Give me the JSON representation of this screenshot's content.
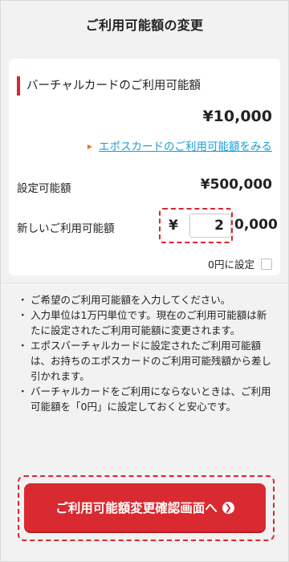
{
  "header": {
    "title": "ご利用可能額の変更"
  },
  "virtual_card": {
    "section_title": "バーチャルカードのご利用可能額",
    "current_amount": "¥10,000",
    "epos_link": "エポスカードのご利用可能額をみる"
  },
  "limit": {
    "label": "設定可能額",
    "value": "¥500,000"
  },
  "new_limit": {
    "label": "新しいご利用可能額",
    "currency": "¥",
    "input_value": "2",
    "suffix": "0,000",
    "zero_label": "0円に設定",
    "zero_checked": false
  },
  "notes": [
    {
      "bullet": "・",
      "text": "ご希望のご利用可能額を入力してください。"
    },
    {
      "bullet": "・",
      "text": "入力単位は1万円単位です。現在のご利用可能額は新たに設定されたご利用可能額に変更されます。"
    },
    {
      "bullet": "・",
      "text": "エポスバーチャルカードに設定されたご利用可能額は、お持ちのエポスカードのご利用可能残額から差し引かれます。"
    },
    {
      "bullet": "・",
      "text": "バーチャルカードをご利用にならないときは、ご利用可能額を「0円」に設定しておくと安心です。"
    }
  ],
  "cta": {
    "label": "ご利用可能額変更確認画面へ",
    "icon": "chevron-right-circle-icon"
  },
  "colors": {
    "accent_red": "#da2a31",
    "link_blue": "#1a9ed9",
    "link_marker": "#e07b1a"
  }
}
